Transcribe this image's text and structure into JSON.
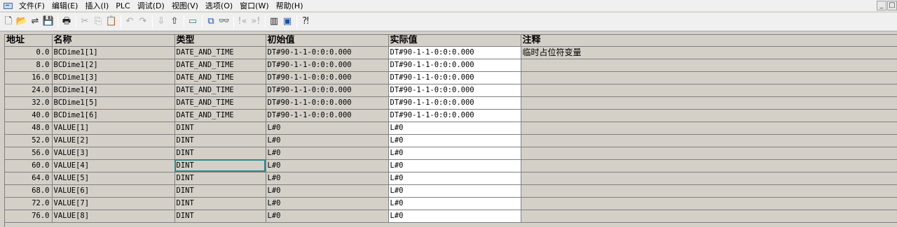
{
  "menu": {
    "items": [
      "文件(F)",
      "编辑(E)",
      "插入(I)",
      "PLC",
      "调试(D)",
      "视图(V)",
      "选项(O)",
      "窗口(W)",
      "帮助(H)"
    ],
    "window_buttons": [
      "_",
      "□"
    ]
  },
  "toolbar": {
    "buttons": [
      {
        "name": "new-icon",
        "glyph": "🗋"
      },
      {
        "name": "open-icon",
        "glyph": "📂"
      },
      {
        "name": "accessible-nodes-icon",
        "glyph": "⇌"
      },
      {
        "name": "save-icon",
        "glyph": "💾"
      },
      {
        "sep": true
      },
      {
        "name": "print-icon",
        "glyph": "🖶"
      },
      {
        "sep": true
      },
      {
        "name": "cut-icon",
        "glyph": "✂",
        "dim": true
      },
      {
        "name": "copy-icon",
        "glyph": "⎘",
        "dim": true
      },
      {
        "name": "paste-icon",
        "glyph": "📋",
        "dim": true
      },
      {
        "sep": true
      },
      {
        "name": "undo-icon",
        "glyph": "↶",
        "dim": true
      },
      {
        "name": "redo-icon",
        "glyph": "↷",
        "dim": true
      },
      {
        "sep": true
      },
      {
        "name": "download-icon",
        "glyph": "⇩",
        "dim": true
      },
      {
        "name": "upload-icon",
        "glyph": "⇧"
      },
      {
        "sep": true
      },
      {
        "name": "declaration-view-icon",
        "glyph": "▭",
        "teal": true
      },
      {
        "sep": true
      },
      {
        "name": "network-icon",
        "glyph": "⧉",
        "blue": true
      },
      {
        "name": "monitor-icon",
        "glyph": "👓",
        "dim": true
      },
      {
        "sep": true
      },
      {
        "name": "first-icon",
        "glyph": "!«",
        "dim": true
      },
      {
        "name": "last-icon",
        "glyph": "»!",
        "dim": true
      },
      {
        "sep": true
      },
      {
        "name": "overview-icon",
        "glyph": "▥"
      },
      {
        "name": "window-icon",
        "glyph": "▣",
        "blue": true
      },
      {
        "sep": true
      },
      {
        "name": "help-icon",
        "glyph": "⁈"
      }
    ]
  },
  "table": {
    "columns": [
      "地址",
      "名称",
      "类型",
      "初始值",
      "实际值",
      "注释"
    ],
    "rows": [
      {
        "addr": "0.0",
        "name": "BCDime1[1]",
        "type": "DATE_AND_TIME",
        "init": "DT#90-1-1-0:0:0.000",
        "actual": "DT#90-1-1-0:0:0.000",
        "comment": "临时占位符变量"
      },
      {
        "addr": "8.0",
        "name": "BCDime1[2]",
        "type": "DATE_AND_TIME",
        "init": "DT#90-1-1-0:0:0.000",
        "actual": "DT#90-1-1-0:0:0.000",
        "comment": ""
      },
      {
        "addr": "16.0",
        "name": "BCDime1[3]",
        "type": "DATE_AND_TIME",
        "init": "DT#90-1-1-0:0:0.000",
        "actual": "DT#90-1-1-0:0:0.000",
        "comment": ""
      },
      {
        "addr": "24.0",
        "name": "BCDime1[4]",
        "type": "DATE_AND_TIME",
        "init": "DT#90-1-1-0:0:0.000",
        "actual": "DT#90-1-1-0:0:0.000",
        "comment": ""
      },
      {
        "addr": "32.0",
        "name": "BCDime1[5]",
        "type": "DATE_AND_TIME",
        "init": "DT#90-1-1-0:0:0.000",
        "actual": "DT#90-1-1-0:0:0.000",
        "comment": ""
      },
      {
        "addr": "40.0",
        "name": "BCDime1[6]",
        "type": "DATE_AND_TIME",
        "init": "DT#90-1-1-0:0:0.000",
        "actual": "DT#90-1-1-0:0:0.000",
        "comment": ""
      },
      {
        "addr": "48.0",
        "name": "VALUE[1]",
        "type": "DINT",
        "init": "L#0",
        "actual": "L#0",
        "comment": ""
      },
      {
        "addr": "52.0",
        "name": "VALUE[2]",
        "type": "DINT",
        "init": "L#0",
        "actual": "L#0",
        "comment": ""
      },
      {
        "addr": "56.0",
        "name": "VALUE[3]",
        "type": "DINT",
        "init": "L#0",
        "actual": "L#0",
        "comment": ""
      },
      {
        "addr": "60.0",
        "name": "VALUE[4]",
        "type": "DINT",
        "init": "L#0",
        "actual": "L#0",
        "comment": "",
        "selected_col": "type"
      },
      {
        "addr": "64.0",
        "name": "VALUE[5]",
        "type": "DINT",
        "init": "L#0",
        "actual": "L#0",
        "comment": ""
      },
      {
        "addr": "68.0",
        "name": "VALUE[6]",
        "type": "DINT",
        "init": "L#0",
        "actual": "L#0",
        "comment": ""
      },
      {
        "addr": "72.0",
        "name": "VALUE[7]",
        "type": "DINT",
        "init": "L#0",
        "actual": "L#0",
        "comment": ""
      },
      {
        "addr": "76.0",
        "name": "VALUE[8]",
        "type": "DINT",
        "init": "L#0",
        "actual": "L#0",
        "comment": ""
      }
    ]
  },
  "colors": {
    "selection_outline": "#2e8a8a",
    "grid_background": "#d4d0c8",
    "actual_cell_background": "#ffffff"
  }
}
